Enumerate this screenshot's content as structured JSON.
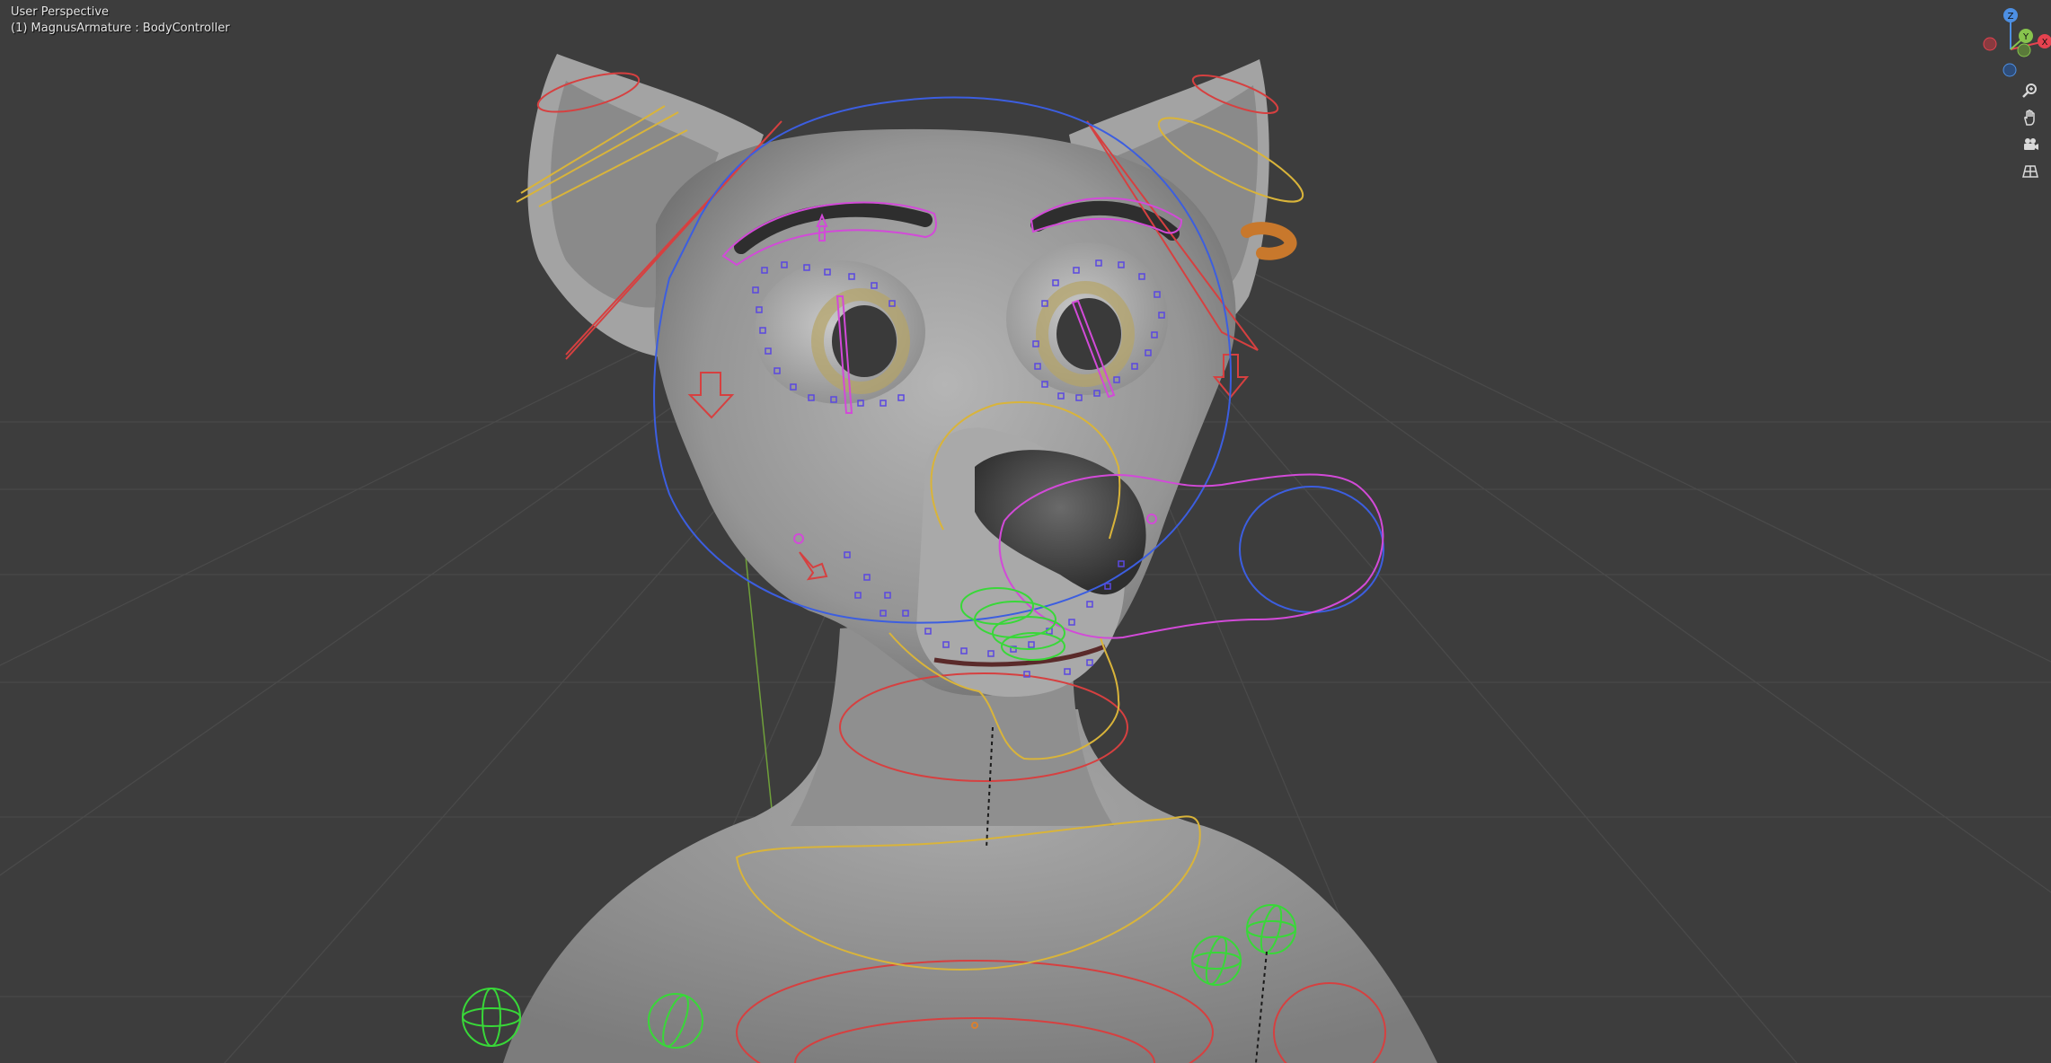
{
  "viewport": {
    "view_label": "User Perspective",
    "object_label": "(1) MagnusArmature : BodyController"
  },
  "gizmo": {
    "axis_z": "Z",
    "axis_y": "Y",
    "axis_x": "X",
    "colors": {
      "x": "#e5424f",
      "y": "#87c44d",
      "z": "#4d8fe3"
    }
  },
  "nav_buttons": [
    {
      "icon": "zoom-icon"
    },
    {
      "icon": "pan-hand-icon"
    },
    {
      "icon": "camera-icon"
    },
    {
      "icon": "grid-ortho-icon"
    }
  ],
  "colors": {
    "background": "#3d3d3d",
    "mesh": "#9a9a9a",
    "rig_red": "#d64040",
    "rig_yellow": "#d9b43a",
    "rig_blue": "#3c5ee0",
    "rig_magenta": "#d24ad8",
    "rig_green": "#38d838",
    "ring_orange": "#c8782c"
  }
}
